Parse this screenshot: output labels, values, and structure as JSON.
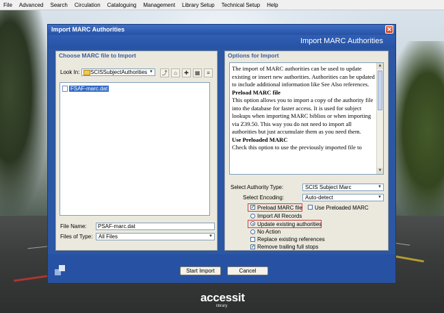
{
  "menubar": {
    "items": [
      "File",
      "Advanced",
      "Search",
      "Circulation",
      "Cataloguing",
      "Management",
      "Library Setup",
      "Technical Setup",
      "Help"
    ]
  },
  "dialog": {
    "title": "Import MARC Authorities",
    "header": "Import MARC Authorities",
    "close": "✕",
    "left": {
      "heading": "Choose MARC file to Import",
      "look_in_label": "Look In:",
      "look_in_value": "SCISSubjectAuthorities",
      "files": [
        "FSAF-marc.dat"
      ],
      "file_name_label": "File Name:",
      "file_name_value": "PSAF-marc.dat",
      "files_of_type_label": "Files of Type:",
      "files_of_type_value": "All Files"
    },
    "right": {
      "heading": "Options for Import",
      "info": {
        "p1": "The import of MARC authorities can be used to update existing or insert new authorities. Authorities can be updated to include additional information like See Also references.",
        "h1": "Preload MARC file",
        "p2": "This option allows you to import a copy of the authority file into the database for faster access. It is used for subject lookups when importing MARC biblios or when importing via Z39.50. This way you do not need to import all authorities but just accumulate them as you need them.",
        "h2": "Use Preloaded MARC",
        "p3": "Check this option to use the previously imported file to"
      },
      "authority_type_label": "Select Authority Type:",
      "authority_type_value": "SCIS Subject Marc",
      "encoding_label": "Select Encoding:",
      "encoding_value": "Auto-detect",
      "options": {
        "preload": "Preload MARC file",
        "use_preloaded": "Use Preloaded MARC",
        "import_all": "Import All Records",
        "update_existing": "Update existing authorities",
        "no_action": "No Action",
        "replace_refs": "Replace existing references",
        "remove_stops": "Remove trailing full stops"
      }
    },
    "buttons": {
      "start": "Start Import",
      "cancel": "Cancel"
    }
  },
  "brand": {
    "name": "accessit",
    "sub": "library"
  },
  "colors": {
    "dialog_blue": "#2b57a4",
    "panel_bg": "#ebe9de",
    "heading_blue": "#3a5c9e",
    "highlight_red": "#d23a3a"
  }
}
